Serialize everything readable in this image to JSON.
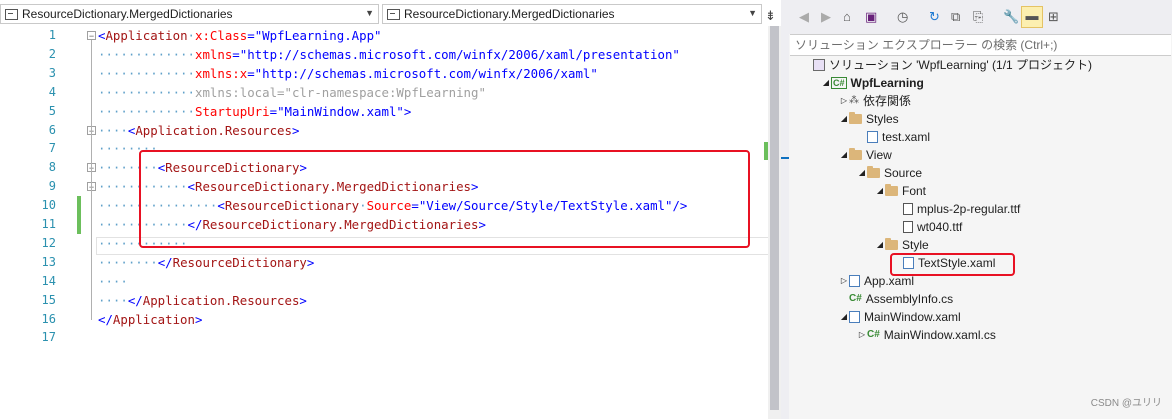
{
  "editor": {
    "nav_left": "ResourceDictionary.MergedDictionaries",
    "nav_right": "ResourceDictionary.MergedDictionaries",
    "lines": [
      {
        "n": "1",
        "dots": "",
        "parts": [
          [
            "br",
            "<"
          ],
          [
            "tag",
            "Application"
          ],
          [
            "dots",
            "·"
          ],
          [
            "attr",
            "x:Class"
          ],
          [
            "br",
            "="
          ],
          [
            "val",
            "\"WpfLearning.App\""
          ]
        ]
      },
      {
        "n": "2",
        "dots": "·············",
        "parts": [
          [
            "attr",
            "xmlns"
          ],
          [
            "br",
            "="
          ],
          [
            "val",
            "\"http://schemas.microsoft.com/winfx/2006/xaml/presentation\""
          ]
        ]
      },
      {
        "n": "3",
        "dots": "·············",
        "parts": [
          [
            "attr",
            "xmlns:x"
          ],
          [
            "br",
            "="
          ],
          [
            "val",
            "\"http://schemas.microsoft.com/winfx/2006/xaml\""
          ]
        ]
      },
      {
        "n": "4",
        "dots": "·············",
        "parts": [
          [
            "grey",
            "xmlns:local=\"clr-namespace:WpfLearning\""
          ]
        ]
      },
      {
        "n": "5",
        "dots": "·············",
        "parts": [
          [
            "attr",
            "StartupUri"
          ],
          [
            "br",
            "="
          ],
          [
            "val",
            "\"MainWindow.xaml\""
          ],
          [
            "br",
            ">"
          ]
        ]
      },
      {
        "n": "6",
        "dots": "····",
        "parts": [
          [
            "br",
            "<"
          ],
          [
            "tag",
            "Application.Resources"
          ],
          [
            "br",
            ">"
          ]
        ]
      },
      {
        "n": "7",
        "dots": "········",
        "parts": []
      },
      {
        "n": "8",
        "dots": "········",
        "parts": [
          [
            "br",
            "<"
          ],
          [
            "tag",
            "ResourceDictionary"
          ],
          [
            "br",
            ">"
          ]
        ]
      },
      {
        "n": "9",
        "dots": "············",
        "parts": [
          [
            "br",
            "<"
          ],
          [
            "tag",
            "ResourceDictionary.MergedDictionaries"
          ],
          [
            "br",
            ">"
          ]
        ]
      },
      {
        "n": "10",
        "dots": "················",
        "parts": [
          [
            "br",
            "<"
          ],
          [
            "tag",
            "ResourceDictionary"
          ],
          [
            "dots",
            "·"
          ],
          [
            "attr",
            "Source"
          ],
          [
            "br",
            "="
          ],
          [
            "val",
            "\"View/Source/Style/TextStyle.xaml\""
          ],
          [
            "br",
            "/>"
          ]
        ]
      },
      {
        "n": "11",
        "dots": "············",
        "parts": [
          [
            "br",
            "</"
          ],
          [
            "tag",
            "ResourceDictionary.MergedDictionaries"
          ],
          [
            "br",
            ">"
          ]
        ]
      },
      {
        "n": "12",
        "dots": "············",
        "parts": []
      },
      {
        "n": "13",
        "dots": "········",
        "parts": [
          [
            "br",
            "</"
          ],
          [
            "tag",
            "ResourceDictionary"
          ],
          [
            "br",
            ">"
          ]
        ]
      },
      {
        "n": "14",
        "dots": "····",
        "parts": []
      },
      {
        "n": "15",
        "dots": "····",
        "parts": [
          [
            "br",
            "</"
          ],
          [
            "tag",
            "Application.Resources"
          ],
          [
            "br",
            ">"
          ]
        ]
      },
      {
        "n": "16",
        "dots": "",
        "parts": [
          [
            "br",
            "</"
          ],
          [
            "tag",
            "Application"
          ],
          [
            "br",
            ">"
          ]
        ]
      },
      {
        "n": "17",
        "dots": "",
        "parts": []
      }
    ]
  },
  "solution_explorer": {
    "search_placeholder": "ソリューション エクスプローラー の検索 (Ctrl+;)",
    "tree": [
      {
        "label": "ソリューション 'WpfLearning' (1/1 プロジェクト)",
        "icon": "sln"
      },
      {
        "label": "WpfLearning",
        "icon": "proj",
        "bold": true,
        "exp": "expanded"
      },
      {
        "label": "依存関係",
        "icon": "dep",
        "exp": "collapsed"
      },
      {
        "label": "Styles",
        "icon": "folder",
        "exp": "expanded"
      },
      {
        "label": "test.xaml",
        "icon": "xaml"
      },
      {
        "label": "View",
        "icon": "folder",
        "exp": "expanded"
      },
      {
        "label": "Source",
        "icon": "folder",
        "exp": "expanded"
      },
      {
        "label": "Font",
        "icon": "folder",
        "exp": "expanded"
      },
      {
        "label": "mplus-2p-regular.ttf",
        "icon": "file"
      },
      {
        "label": "wt040.ttf",
        "icon": "file"
      },
      {
        "label": "Style",
        "icon": "folder",
        "exp": "expanded"
      },
      {
        "label": "TextStyle.xaml",
        "icon": "xaml"
      },
      {
        "label": "App.xaml",
        "icon": "xaml",
        "exp": "collapsed"
      },
      {
        "label": "AssemblyInfo.cs",
        "icon": "cs"
      },
      {
        "label": "MainWindow.xaml",
        "icon": "xaml",
        "exp": "expanded"
      },
      {
        "label": "MainWindow.xaml.cs",
        "icon": "cs",
        "exp": "collapsed"
      }
    ]
  },
  "watermark": "CSDN @ユリリ",
  "colors": {
    "highlight_box": "#e81123",
    "accent": "#0e70c0",
    "change_bar": "#6cbf5c"
  }
}
